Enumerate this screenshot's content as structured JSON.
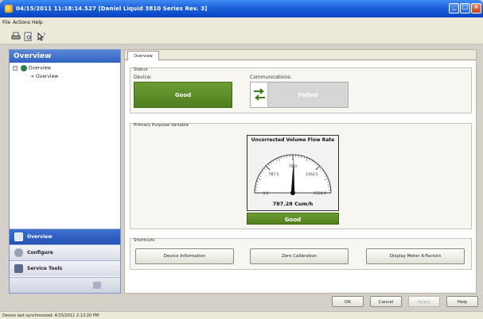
{
  "window": {
    "title": "04/15/2011 11:18:14.527 [Daniel Liquid 3810 Series Rev. 3]"
  },
  "menu": [
    "File",
    "Actions",
    "Help"
  ],
  "sidebar": {
    "header": "Overview",
    "tree": {
      "root": "Overview",
      "child": "Overview"
    },
    "nav": [
      {
        "label": "Overview",
        "icon": "overview-icon",
        "active": true
      },
      {
        "label": "Configure",
        "icon": "configure-icon",
        "active": false
      },
      {
        "label": "Service Tools",
        "icon": "service-tools-icon",
        "active": false
      }
    ]
  },
  "tabs": [
    "Overview"
  ],
  "status": {
    "title": "Status",
    "device_label": "Device:",
    "device_value": "Good",
    "comms_label": "Communications:",
    "comms_value": "Polled"
  },
  "ppv": {
    "title": "Primary Purpose Variable",
    "gauge_title": "Uncorrected Volume Flow Rate",
    "ticks": [
      "0.0",
      "787.5",
      "75.0",
      "1162.5",
      "1550.0"
    ],
    "value_text": "787.28 Cum/h",
    "value": 787.28,
    "min": 0,
    "max": 1550,
    "status": "Good"
  },
  "shortcuts": {
    "title": "Shortcuts",
    "buttons": [
      "Device Information",
      "Zero Calibration",
      "Display Meter K-Factors"
    ]
  },
  "dialog_buttons": {
    "ok": "OK",
    "cancel": "Cancel",
    "apply": "Apply",
    "help": "Help"
  },
  "statusbar": "Device last synchronized: 4/15/2011 2:13:20 PM",
  "colors": {
    "title_blue": "#1c5fd9",
    "good_green": "#5b8a28",
    "nav_active": "#2f5fc4"
  }
}
